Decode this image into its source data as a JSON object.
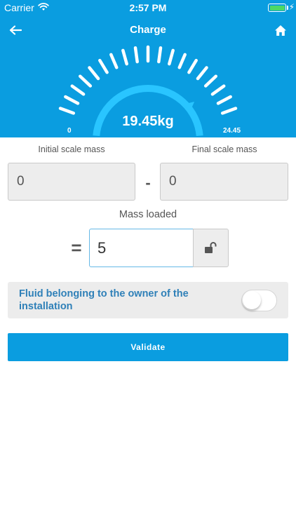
{
  "status_bar": {
    "carrier": "Carrier",
    "time": "2:57 PM"
  },
  "header": {
    "title": "Charge"
  },
  "gauge": {
    "value_text": "19.45kg",
    "min_label": "0",
    "max_label": "24.45",
    "value": 19.45,
    "min": 0,
    "max": 24.45
  },
  "form": {
    "initial_label": "Initial scale mass",
    "initial_value": "0",
    "minus": "-",
    "final_label": "Final scale mass",
    "final_value": "0",
    "loaded_label": "Mass loaded",
    "equals": "=",
    "loaded_value": "5"
  },
  "toggle": {
    "label": "Fluid belonging to the owner of the installation",
    "on": false
  },
  "validate": {
    "label": "Validate"
  },
  "colors": {
    "primary": "#0a9de0",
    "accent": "#29c5ff",
    "label": "#2f80b8",
    "field_bg": "#ededed"
  },
  "icons": {
    "back": "arrow-left-icon",
    "home": "home-icon",
    "lock": "unlock-icon",
    "wifi": "wifi-icon",
    "battery": "battery-icon"
  }
}
